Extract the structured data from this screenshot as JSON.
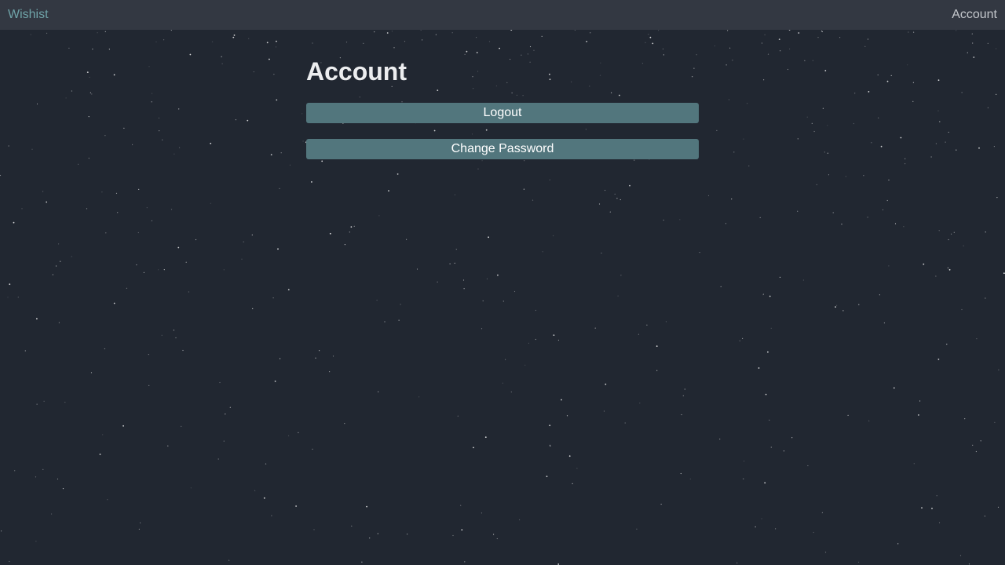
{
  "nav": {
    "brand": "Wishist",
    "account_label": "Account"
  },
  "main": {
    "title": "Account",
    "logout_label": "Logout",
    "change_password_label": "Change Password"
  },
  "colors": {
    "background": "#212731",
    "topbar": "#333842",
    "brand": "#6fa3a8",
    "button": "#52767d"
  }
}
